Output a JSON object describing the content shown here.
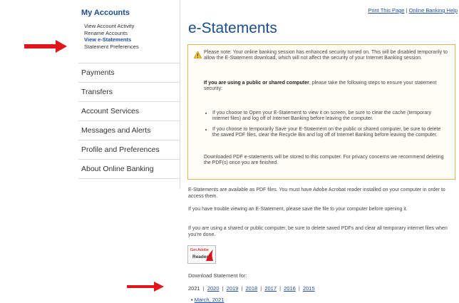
{
  "sidebar": {
    "title": "My Accounts",
    "sub_items": [
      "View Account Activity",
      "Rename Accounts",
      "View e-Statements",
      "Statement Preferences"
    ],
    "nav_items": [
      "Payments",
      "Transfers",
      "Account Services",
      "Messages and Alerts",
      "Profile and Preferences",
      "About Online Banking"
    ]
  },
  "header": {
    "print_link": "Print This Page",
    "separator": "|",
    "help_link": "Online Banking Help"
  },
  "page": {
    "title": "e-Statements"
  },
  "notice": {
    "p1": "Please note: Your online banking session has enhanced security turned on. This will be disabled temporarily to allow the E-Statement download, which will not affect the security of your Internet Banking session.",
    "p2_bold": "If you are using a public or shared computer",
    "p2_rest": ", please take the following steps to ensure your statement security:",
    "bullet1": "If you choose to Open your E-Statement to view it on screen, be sure to clear the cache (temporary internet files) and log off of Internet Banking before leaving the computer.",
    "bullet2": "If you choose to temporarily Save your E-Statement on the public or shared computer, be sure to delete the saved PDF files, clear the Recycle Bin and log off of Internet Banking before leaving the computer.",
    "p3": "Downloaded PDF e-statements will be stored to this computer. For privacy concerns we recommend deleting the PDF(s) once you are finished."
  },
  "info": {
    "p1": "E-Statements are available as PDF files. You must have Adobe Acrobat reader installed on your computer in order to access them.",
    "p2": "If you have trouble viewing an E-Statement, please save the file to your computer before opening it.",
    "p3": "If you are using a shared or public computer, be sure to delete saved PDFs and clear all temporary internet files when you're done."
  },
  "adobe": {
    "line1": "Get Adobe",
    "line2": "Reader"
  },
  "download": {
    "label": "Download Statement for:",
    "current_year": "2021",
    "years": [
      "2020",
      "2019",
      "2018",
      "2017",
      "2016",
      "2015"
    ],
    "month": "March, 2021"
  },
  "colors": {
    "accent": "#1c4d8c",
    "link": "#1e4fa8",
    "arrow": "#e0161b",
    "notice_border": "#e1b657"
  }
}
